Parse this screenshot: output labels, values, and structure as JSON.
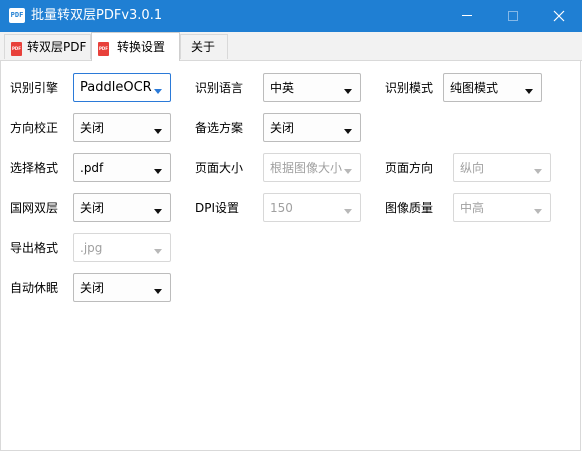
{
  "window": {
    "title": "批量转双层PDFv3.0.1",
    "app_icon_text": "PDF",
    "colors": {
      "titlebar": "#1f7fd3",
      "focus": "#2b7ad8",
      "pdf_icon": "#e8413b"
    }
  },
  "tabs": [
    {
      "label": "转双层PDF",
      "icon": "pdf-icon",
      "active": false
    },
    {
      "label": "转换设置",
      "icon": "pdf-icon",
      "active": true
    },
    {
      "label": "关于",
      "active": false
    }
  ],
  "settings": {
    "ocr_engine": {
      "label": "识别引擎",
      "value": "PaddleOCR"
    },
    "ocr_language": {
      "label": "识别语言",
      "value": "中英"
    },
    "ocr_mode": {
      "label": "识别模式",
      "value": "纯图模式"
    },
    "orientation_fix": {
      "label": "方向校正",
      "value": "关闭"
    },
    "fallback_plan": {
      "label": "备选方案",
      "value": "关闭"
    },
    "format": {
      "label": "选择格式",
      "value": ".pdf"
    },
    "page_size": {
      "label": "页面大小",
      "value": "根据图像大小"
    },
    "page_orientation": {
      "label": "页面方向",
      "value": "纵向"
    },
    "guowang_dual": {
      "label": "国网双层",
      "value": "关闭"
    },
    "dpi": {
      "label": "DPI设置",
      "value": "150"
    },
    "image_quality": {
      "label": "图像质量",
      "value": "中高"
    },
    "export_format": {
      "label": "导出格式",
      "value": ".jpg"
    },
    "auto_sleep": {
      "label": "自动休眠",
      "value": "关闭"
    }
  }
}
